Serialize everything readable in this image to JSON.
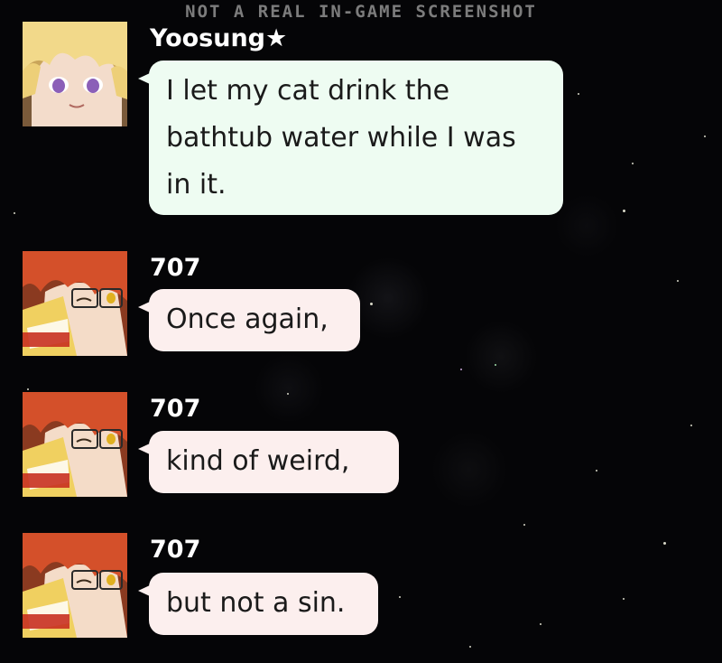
{
  "watermark": "NOT A REAL IN-GAME SCREENSHOT",
  "messages": [
    {
      "sender": "Yoosung★",
      "text": "I let my cat drink the bathtub water while I was in it.",
      "avatar": "yoosung-avatar",
      "bubble_color": "#eefcf2"
    },
    {
      "sender": "707",
      "text": "Once again,",
      "avatar": "707-avatar",
      "bubble_color": "#fcefee"
    },
    {
      "sender": "707",
      "text": "kind of weird,",
      "avatar": "707-avatar",
      "bubble_color": "#fcefee"
    },
    {
      "sender": "707",
      "text": "but not a sin.",
      "avatar": "707-avatar",
      "bubble_color": "#fcefee"
    }
  ],
  "colors": {
    "background": "#050507",
    "sender_text": "#ffffff",
    "watermark_text": "#7c7c7c"
  }
}
